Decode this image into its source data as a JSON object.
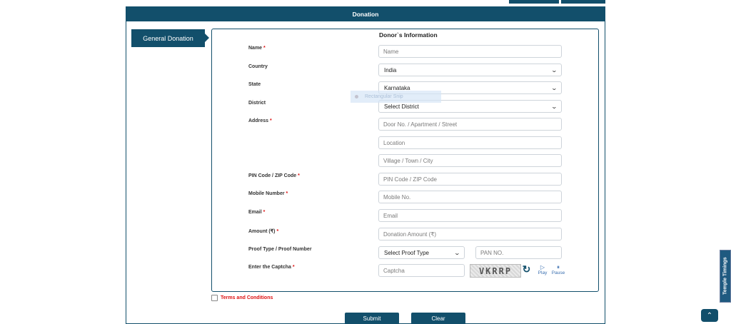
{
  "header": {
    "title": "Donation"
  },
  "sidebar": {
    "tab_label": "General Donation"
  },
  "form": {
    "title": "Donor`s Information",
    "required_mark": "*",
    "labels": {
      "name": "Name",
      "country": "Country",
      "state": "State",
      "district": "District",
      "address": "Address",
      "pin": "PIN Code / ZIP Code",
      "mobile": "Mobile Number",
      "email": "Email",
      "amount": "Amount (₹)",
      "proof": "Proof Type / Proof Number",
      "captcha": "Enter the Captcha"
    },
    "placeholders": {
      "name": "Name",
      "address_line1": "Door No. / Apartment / Street",
      "address_location": "Location",
      "address_city": "Village / Town / City",
      "pin": "PIN Code / ZIP Code",
      "mobile": "Mobile No.",
      "email": "Email",
      "amount": "Donation Amount (₹)",
      "pan": "PAN NO.",
      "captcha": "Captcha"
    },
    "selects": {
      "country": "India",
      "state": "Karnataka",
      "district": "Select District",
      "proof_type": "Select Proof Type"
    },
    "captcha_text": "VKRRP",
    "audio": {
      "play": "Play",
      "pause": "Pause"
    },
    "terms_label": "Terms and Conditions"
  },
  "buttons": {
    "submit": "Submit",
    "clear": "Clear"
  },
  "float": {
    "temple_timings": "Temple Timings"
  },
  "tooltip": {
    "text": "Rectangular Snip"
  },
  "icons": {
    "chevron": "chevron-down-icon",
    "refresh": "refresh-icon",
    "play": "play-icon",
    "pause": "pause-icon",
    "scroll_top": "chevron-up-icon"
  },
  "colors": {
    "primary": "#124f6b",
    "required": "#dd1111",
    "link": "#3a6fb0"
  }
}
